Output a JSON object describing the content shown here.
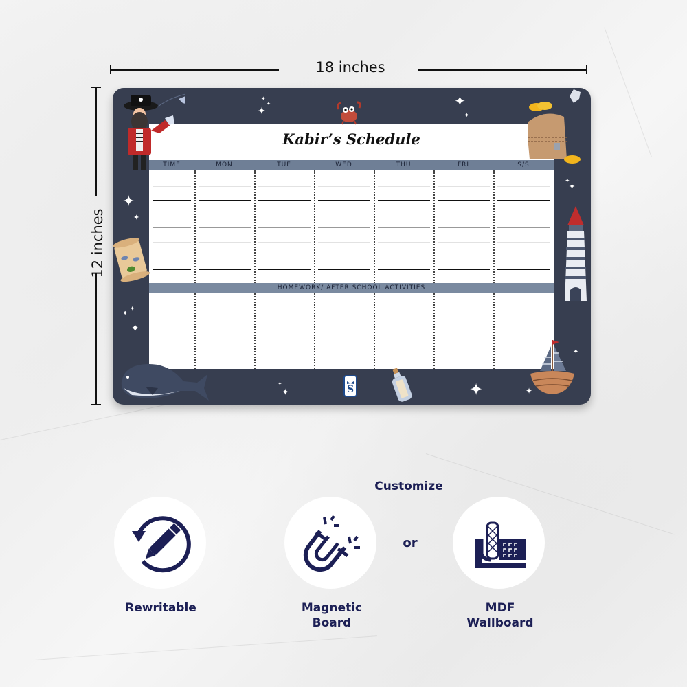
{
  "dimensions": {
    "width_label": "18 inches",
    "height_label": "12 inches"
  },
  "board": {
    "title": "Kabir’s Schedule",
    "columns": [
      "TIME",
      "MON",
      "TUE",
      "WED",
      "THU",
      "FRI",
      "S/S"
    ],
    "section_label": "HOMEWORK/ AFTER SCHOOL ACTIVITIES",
    "colors": {
      "board": "#373e50",
      "header_band": "#6f7f96",
      "section_band": "#7a8aa0"
    },
    "decorations": [
      "pirate",
      "crab",
      "treasure-chest",
      "treasure-map",
      "lighthouse",
      "whale",
      "brand-logo",
      "message-bottle",
      "sailboat",
      "sparkles"
    ]
  },
  "features": {
    "customize_label": "Customize",
    "or_label": "or",
    "items": [
      {
        "icon": "rewrite-pencil-icon",
        "label_line1": "Rewritable",
        "label_line2": ""
      },
      {
        "icon": "magnet-icon",
        "label_line1": "Magnetic",
        "label_line2": "Board"
      },
      {
        "icon": "mdf-wallboard-icon",
        "label_line1": "MDF",
        "label_line2": "Wallboard"
      }
    ],
    "accent_color": "#1c1f55"
  }
}
